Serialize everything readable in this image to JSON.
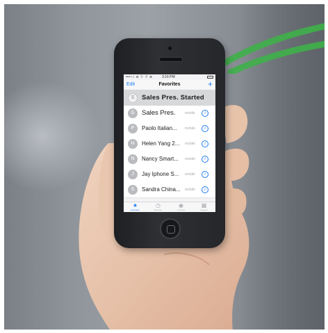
{
  "status_bar": {
    "carrier": "•••○○ ≋ ⌔ ⌔ ≋",
    "time": "3:16 PM"
  },
  "navbar": {
    "edit_label": "Edit",
    "title": "Favorites",
    "add_label": "+"
  },
  "favorites": [
    {
      "initial": "S",
      "name": "Sales Pres. Started",
      "type": "",
      "highlighted": true
    },
    {
      "initial": "G",
      "name": "Sales Pres.",
      "type": "mobile",
      "highlighted": false
    },
    {
      "initial": "P",
      "name": "Paolo Italian...",
      "type": "mobile",
      "highlighted": false
    },
    {
      "initial": "H",
      "name": "Helen Yang 2...",
      "type": "mobile",
      "highlighted": false
    },
    {
      "initial": "N",
      "name": "Nancy Smart...",
      "type": "mobile",
      "highlighted": false
    },
    {
      "initial": "J",
      "name": "Jay Iphone S...",
      "type": "mobile",
      "highlighted": false
    },
    {
      "initial": "S",
      "name": "Sandra China...",
      "type": "mobile",
      "highlighted": false
    }
  ],
  "info_glyph": "i",
  "tabbar": [
    {
      "icon": "★",
      "label": "Favorites",
      "active": true
    },
    {
      "icon": "◷",
      "label": "Recents",
      "active": false
    },
    {
      "icon": "◉",
      "label": "Contacts",
      "active": false
    },
    {
      "icon": "▦",
      "label": "Keypad",
      "active": false
    }
  ],
  "colors": {
    "accent": "#1a7cf2",
    "signal": "#3fb04a",
    "highlight_row": "#d7d8da"
  }
}
